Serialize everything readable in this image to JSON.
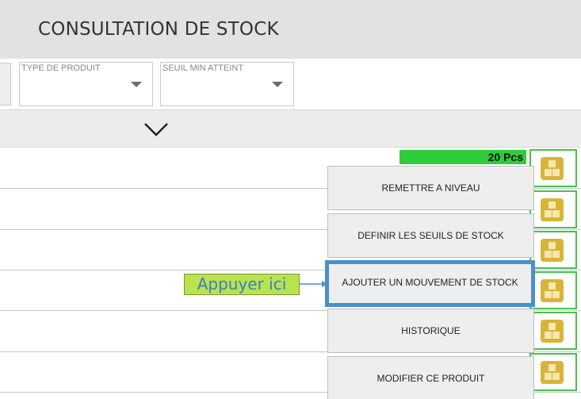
{
  "header": {
    "title": "CONSULTATION DE STOCK"
  },
  "filters": [
    {
      "label": "TYPE DE PRODUIT",
      "value": ""
    },
    {
      "label": "SEUIL MIN ATTEINT",
      "value": ""
    }
  ],
  "collapse": {
    "icon": "chevron-down-icon"
  },
  "rows": [
    {
      "quantity": "20 Pcs"
    }
  ],
  "row_action": {
    "icon": "boxes-icon",
    "color": "#d9b43a",
    "border_color": "#46c24f"
  },
  "menu": {
    "items": [
      "REMETTRE A NIVEAU",
      "DEFINIR LES SEUILS DE STOCK",
      "AJOUTER UN MOUVEMENT DE STOCK",
      "HISTORIQUE",
      "MODIFIER CE PRODUIT"
    ],
    "highlighted_item": "AJOUTER UN MOUVEMENT DE STOCK",
    "highlight_color": "#4a90cc"
  },
  "callout": {
    "text": "Appuyer ici",
    "background": "#b9e34e",
    "text_color": "#3d7fc4"
  },
  "colors": {
    "header_bg": "#e2e2e2",
    "quantity_bar": "#2ecc3a"
  }
}
